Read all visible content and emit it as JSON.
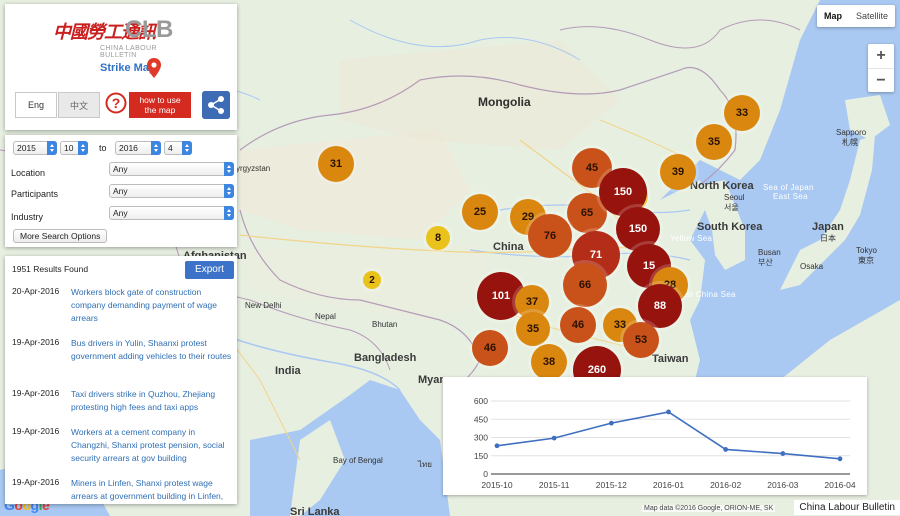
{
  "map": {
    "type_buttons": [
      "Map",
      "Satellite"
    ],
    "active_type": "Map",
    "zoom_in": "+",
    "zoom_out": "−",
    "labels": {
      "mongolia": "Mongolia",
      "china": "China",
      "north_korea": "North Korea",
      "south_korea": "South Korea",
      "japan": "Japan",
      "japan_cn": "日本",
      "sea_of_japan": "Sea of Japan",
      "east_sea": "East Sea",
      "yellow_sea": "Yellow Sea",
      "east_china_sea": "East China Sea",
      "taiwan": "Taiwan",
      "india": "India",
      "nepal": "Nepal",
      "bhutan": "Bhutan",
      "bangladesh": "Bangladesh",
      "bay_of_bengal": "Bay of Bengal",
      "new_delhi": "New Delhi",
      "seoul": "Seoul",
      "seoul_kr": "서울",
      "busan": "Busan",
      "busan_kr": "부산",
      "sapporo": "Sapporo",
      "sapporo_jp": "札幌",
      "tokyo": "Tokyo",
      "tokyo_jp": "東京",
      "osaka": "Osaka",
      "afghanistan": "Afghanistan",
      "kyrgyzstan": "yrgyzstan",
      "myanmar": "Myan",
      "thailand": "ไทย",
      "sri_lanka": "Sri Lanka"
    },
    "clusters": [
      {
        "count": "33",
        "level": "orange"
      },
      {
        "count": "35",
        "level": "orange"
      },
      {
        "count": "31",
        "level": "orange"
      },
      {
        "count": "45",
        "level": "redorange"
      },
      {
        "count": "39",
        "level": "orange"
      },
      {
        "count": "15",
        "level": "yellow"
      },
      {
        "count": "25",
        "level": "orange"
      },
      {
        "count": "29",
        "level": "orange"
      },
      {
        "count": "65",
        "level": "redorange"
      },
      {
        "count": "150",
        "level": "darkred"
      },
      {
        "count": "76",
        "level": "redorange"
      },
      {
        "count": "8",
        "level": "yellow"
      },
      {
        "count": "150",
        "level": "darkred"
      },
      {
        "count": "71",
        "level": "red"
      },
      {
        "count": "15",
        "level": "darkred"
      },
      {
        "count": "28",
        "level": "orange"
      },
      {
        "count": "2",
        "level": "yellow"
      },
      {
        "count": "101",
        "level": "darkred"
      },
      {
        "count": "37",
        "level": "orange"
      },
      {
        "count": "66",
        "level": "redorange"
      },
      {
        "count": "88",
        "level": "darkred"
      },
      {
        "count": "35",
        "level": "orange"
      },
      {
        "count": "46",
        "level": "redorange"
      },
      {
        "count": "33",
        "level": "orange"
      },
      {
        "count": "53",
        "level": "redorange"
      },
      {
        "count": "46",
        "level": "redorange"
      },
      {
        "count": "38",
        "level": "orange"
      },
      {
        "count": "260",
        "level": "darkred"
      }
    ],
    "attribution": "Map data ©2016 Google, ORION-ME, SK",
    "google_logo": "Google",
    "watermark": "China Labour Bulletin"
  },
  "brand": {
    "logo_cn": "中國勞工通訊",
    "logo_en": "CLB",
    "logo_sub": "CHINA LABOUR BULLETIN",
    "title": "Strike Map",
    "lang_eng": "Eng",
    "lang_zh": "中文",
    "howto_line1": "how to use",
    "howto_line2": "the map"
  },
  "search": {
    "from_year": "2015",
    "from_month": "10",
    "to_label": "to",
    "to_year": "2016",
    "to_month": "4",
    "location_label": "Location",
    "location_value": "Any",
    "participants_label": "Participants",
    "participants_value": "Any",
    "industry_label": "Industry",
    "industry_value": "Any",
    "more_label": "More Search Options"
  },
  "results": {
    "count": "1951 Results Found",
    "export_label": "Export",
    "items": [
      {
        "date": "20-Apr-2016",
        "title": "Workers block gate of construction company demanding payment of wage arrears"
      },
      {
        "date": "19-Apr-2016",
        "title": "Bus drivers in Yulin, Shaanxi protest government adding vehicles to their routes"
      },
      {
        "date": "19-Apr-2016",
        "title": "Taxi drivers strike in Quzhou, Zhejiang protesting high fees and taxi apps"
      },
      {
        "date": "19-Apr-2016",
        "title": "Workers at a cement company in Changzhi, Shanxi protest pension, social security arrears at gov building"
      },
      {
        "date": "19-Apr-2016",
        "title": "Miners in Linfen, Shanxi protest wage arrears at government building in Linfen,"
      }
    ]
  },
  "chart_data": {
    "type": "line",
    "categories": [
      "2015-10",
      "2015-11",
      "2015-12",
      "2016-01",
      "2016-02",
      "2016-03",
      "2016-04"
    ],
    "values": [
      232,
      295,
      418,
      510,
      202,
      168,
      125
    ],
    "yticks": [
      0,
      150,
      300,
      450,
      600
    ],
    "ylim": [
      0,
      600
    ],
    "color": "#3f6fc0",
    "title": "",
    "xlabel": "",
    "ylabel": ""
  },
  "colors": {
    "yellow": "#eac21c",
    "orange": "#da870f",
    "redorange": "#c9521b",
    "red": "#b32d19",
    "darkred": "#96130e",
    "land": "#e7efe1",
    "water": "#a9c8f2",
    "brand_red": "#d52a20",
    "link_blue": "#2f6fb5"
  }
}
